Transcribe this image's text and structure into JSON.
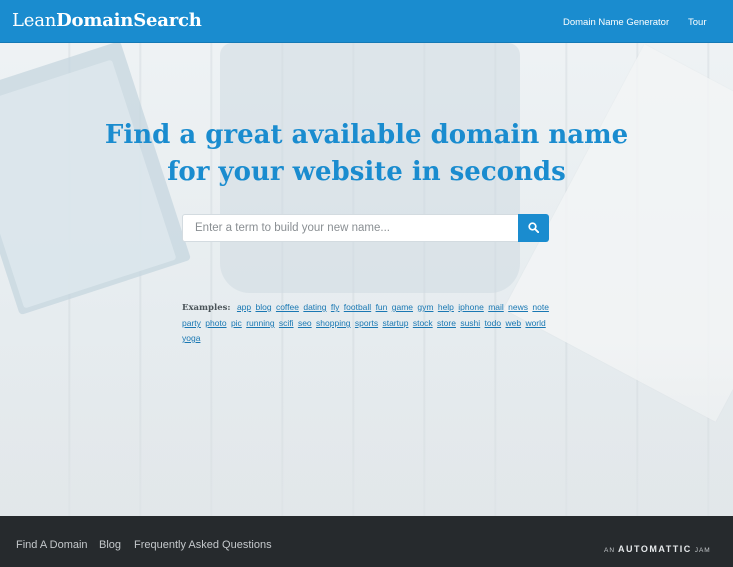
{
  "header": {
    "logo_light": "Lean",
    "logo_bold": "DomainSearch",
    "nav": {
      "generator": "Domain Name Generator",
      "tour": "Tour"
    },
    "color": "#1a8ccf"
  },
  "hero": {
    "headline_line1": "Find a great available domain name",
    "headline_line2": "for your website in seconds",
    "search": {
      "placeholder": "Enter a term to build your new name...",
      "value": "",
      "button_icon": "search-icon"
    },
    "examples_label": "Examples:",
    "examples": [
      "app",
      "blog",
      "coffee",
      "dating",
      "fly",
      "football",
      "fun",
      "game",
      "gym",
      "help",
      "iphone",
      "mail",
      "news",
      "note",
      "party",
      "photo",
      "pic",
      "running",
      "scifi",
      "seo",
      "shopping",
      "sports",
      "startup",
      "stock",
      "store",
      "sushi",
      "todo",
      "web",
      "world",
      "yoga"
    ]
  },
  "footer": {
    "links": [
      "Find A Domain",
      "Blog",
      "Frequently Asked Questions"
    ],
    "jam_prefix": "AN",
    "jam_brand": "AUTOMATTIC",
    "jam_suffix": "JAM",
    "background": "#262a2d"
  }
}
